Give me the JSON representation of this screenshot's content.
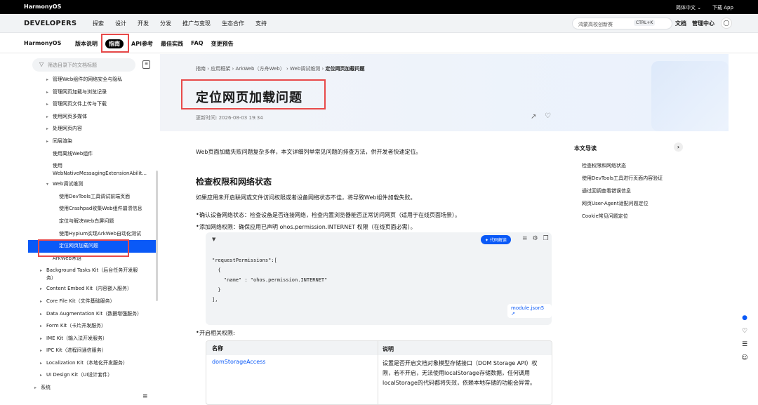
{
  "top_bar": {
    "brand": "HarmonyOS",
    "language": "简体中文 ⌄",
    "download": "下载 App"
  },
  "header": {
    "logo": "DEVELOPERS",
    "items": [
      "探索",
      "设计",
      "开发",
      "分发",
      "推广与变现",
      "生态合作",
      "支持"
    ],
    "search_placeholder": "鸿蒙高校创新赛",
    "search_shortcut": "CTRL+K",
    "docs": "文档",
    "admin": "管理中心"
  },
  "subnav": {
    "logo": "HarmonyOS",
    "tabs": [
      "版本说明",
      "指南",
      "API参考",
      "最佳实践",
      "FAQ",
      "变更预告"
    ],
    "active_tab": "指南"
  },
  "sidebar": {
    "filter_placeholder": "筛选目录下的文档标题",
    "items": [
      {
        "label": "管理Web组件的网络安全与隐私",
        "arrow": "▸",
        "indent": 1
      },
      {
        "label": "管理网页加载与浏览记录",
        "arrow": "▸",
        "indent": 1
      },
      {
        "label": "管理网页文件上传与下载",
        "arrow": "▸",
        "indent": 1
      },
      {
        "label": "使用网页多媒体",
        "arrow": "▸",
        "indent": 1
      },
      {
        "label": "处理网页内容",
        "arrow": "▸",
        "indent": 1
      },
      {
        "label": "同层渲染",
        "arrow": "▸",
        "indent": 1
      },
      {
        "label": "使用离线Web组件",
        "arrow": "",
        "indent": 1
      },
      {
        "label": "使用WebNativeMessagingExtensionAbilit...",
        "arrow": "",
        "indent": 1,
        "two_line": true,
        "line1": "使用",
        "line2": "WebNativeMessagingExtensionAbilit..."
      },
      {
        "label": "Web调试维测",
        "arrow": "▾",
        "indent": 1
      },
      {
        "label": "使用DevTools工具调试前端页面",
        "arrow": "",
        "indent": 2
      },
      {
        "label": "使用Crashpad收集Web组件崩溃信息",
        "arrow": "",
        "indent": 2
      },
      {
        "label": "定位与解决Web白屏问题",
        "arrow": "",
        "indent": 2
      },
      {
        "label": "使用Hypium实现ArkWeb自动化测试",
        "arrow": "",
        "indent": 2
      },
      {
        "label": "定位网页加载问题",
        "arrow": "",
        "indent": 2,
        "active": true
      },
      {
        "label": "ArkWeb术语",
        "arrow": "",
        "indent": 1
      },
      {
        "label": "Background Tasks Kit（后台任务开发服务）",
        "arrow": "▸",
        "indent": 0,
        "two_line": true,
        "line1": "Background Tasks Kit（后台任务开发服",
        "line2": "务）"
      },
      {
        "label": "Content Embed Kit（内容嵌入服务）",
        "arrow": "▸",
        "indent": 0
      },
      {
        "label": "Core File Kit（文件基础服务）",
        "arrow": "▸",
        "indent": 0
      },
      {
        "label": "Data Augmentation Kit（数据增强服务）",
        "arrow": "▸",
        "indent": 0
      },
      {
        "label": "Form Kit（卡片开发服务）",
        "arrow": "▸",
        "indent": 0
      },
      {
        "label": "IME Kit（输入法开发服务）",
        "arrow": "▸",
        "indent": 0
      },
      {
        "label": "IPC Kit（进程间通信服务）",
        "arrow": "▸",
        "indent": 0
      },
      {
        "label": "Localization Kit（本地化开发服务）",
        "arrow": "▸",
        "indent": 0
      },
      {
        "label": "UI Design Kit（UI设计套件）",
        "arrow": "▸",
        "indent": 0
      },
      {
        "label": "系统",
        "arrow": "▸",
        "indent": -1
      }
    ]
  },
  "breadcrumb": [
    "指南",
    "应用框架",
    "ArkWeb（方舟Web）",
    "Web调试维测",
    "定位网页加载问题"
  ],
  "article": {
    "title": "定位网页加载问题",
    "updated": "更新时间: 2026-08-03 19:34",
    "intro": "Web页面加载失败问题复杂多样，本文详细列举常见问题的排查方法，供开发者快速定位。",
    "h2": "检查权限和网络状态",
    "p1": "如果应用未开启联网或文件访问权限或者设备网络状态不佳，将导致Web组件加载失败。",
    "bullet1": "确认设备网络状态：检查设备是否连接网络，检查内置浏览器能否正常访问网页（适用于在线页面场景）。",
    "bullet2": "添加网络权限：确保应用已声明 ohos.permission.INTERNET 权限（在线页面必需）。",
    "code_ai": "✦ 代码解读",
    "code": "\"requestPermissions\":[\n  {\n    \"name\" : \"ohos.permission.INTERNET\"\n  }\n],",
    "code_file": "module.json5 ↗",
    "bullet3": "开启相关权限:",
    "table": {
      "headers": [
        "名称",
        "说明"
      ],
      "rows": [
        [
          "domStorageAccess",
          "设置是否开启文档对象模型存储接口（DOM Storage API）权限，若不开启，无法使用localStorage存储数据，任何调用localStorage的代码都将失效，依赖本地存储的功能会异常。"
        ]
      ]
    }
  },
  "toc": {
    "title": "本文导读",
    "items": [
      "检查权限和网络状态",
      "使用DevTools工具进行页面内容验证",
      "通过回调查看错误信息",
      "网页User-Agent适配问题定位",
      "Cookie常见问题定位"
    ]
  },
  "colors": {
    "accent": "#0a59f7",
    "highlight_box": "#e84a4a"
  }
}
